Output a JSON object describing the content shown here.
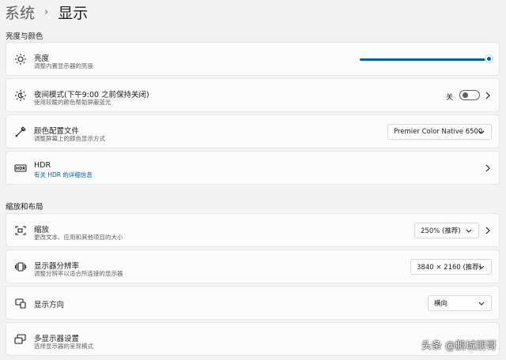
{
  "breadcrumb": {
    "parent": "系统",
    "separator": "›",
    "current": "显示"
  },
  "sections": {
    "brightness_color": "亮度与颜色",
    "scale_layout": "缩放和布局"
  },
  "brightness": {
    "title": "亮度",
    "subtitle": "调整内置显示器的亮度",
    "level": 1.0
  },
  "night_light": {
    "title": "夜间模式(下午9:00 之前保持关闭)",
    "subtitle": "使用较暖的颜色帮助屏蔽蓝光",
    "state": "关"
  },
  "color_profile": {
    "title": "颜色配置文件",
    "subtitle": "调整屏幕上的颜色显示方式",
    "value": "Premier Color Native 6500"
  },
  "hdr": {
    "title": "HDR",
    "subtitle": "有关 HDR 的详细信息"
  },
  "scale": {
    "title": "缩放",
    "subtitle": "更改文本、应用和其他项目的大小",
    "value": "250% (推荐)"
  },
  "resolution": {
    "title": "显示器分辨率",
    "subtitle": "调整分辨率以适合所连接的显示器",
    "value": "3840 × 2160 (推荐)"
  },
  "orientation": {
    "title": "显示方向",
    "value": "横向"
  },
  "multiple_displays": {
    "title": "多显示器设置",
    "subtitle": "选择显示器的呈现模式"
  },
  "watermark": "头条 @鹏城朋哥",
  "colors": {
    "accent": "#005fb8",
    "background": "#f3f3f3",
    "card": "#fbfbfb"
  }
}
